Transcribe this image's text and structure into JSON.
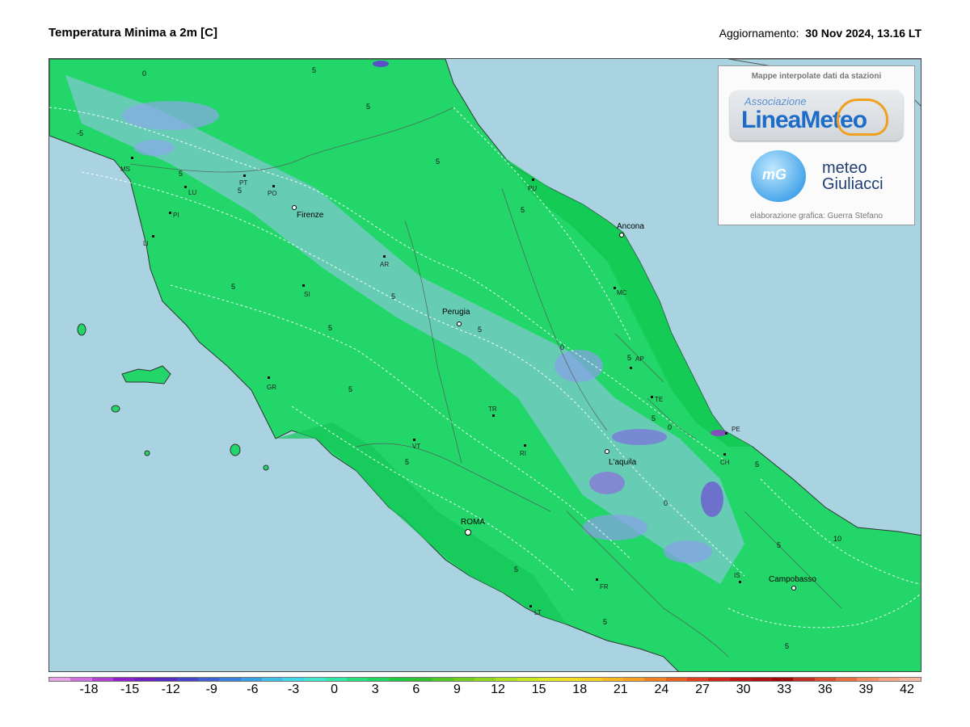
{
  "header": {
    "title": "Temperatura Minima a 2m [C]",
    "updated_label": "Aggiornamento:",
    "updated_value": "30 Nov 2024, 13.16 LT"
  },
  "infobox": {
    "heading": "Mappe interpolate dati da stazioni",
    "logo1_small": "Associazione",
    "logo1_big": "LineaMeteo",
    "logo2_mark": "mG",
    "logo2_line1": "meteo",
    "logo2_line2": "Giuliacci",
    "credit": "elaborazione grafica: Guerra Stefano"
  },
  "map": {
    "sea_color": "#a9d3e0",
    "land_color": "#22d66a",
    "cold_color": "#9fc7f0",
    "cities": [
      "Firenze",
      "Ancona",
      "Perugia",
      "L'aquila",
      "ROMA",
      "Campobasso"
    ],
    "provinces": [
      "MS",
      "LU",
      "PT",
      "PO",
      "PI",
      "LI",
      "SI",
      "AR",
      "GR",
      "PU",
      "MC",
      "AP",
      "TE",
      "PE",
      "CH",
      "TR",
      "VT",
      "RI",
      "FR",
      "LT",
      "IS"
    ],
    "isotherm_labels": [
      "5",
      "0",
      "-5",
      "10"
    ]
  },
  "colorbar": {
    "ticks": [
      "-18",
      "-15",
      "-12",
      "-9",
      "-6",
      "-3",
      "0",
      "3",
      "6",
      "9",
      "12",
      "15",
      "18",
      "21",
      "24",
      "27",
      "30",
      "33",
      "36",
      "39",
      "42"
    ],
    "colors": [
      "#e8a0e8",
      "#d070e0",
      "#b040d0",
      "#9020c8",
      "#7020c0",
      "#5a2cc4",
      "#4a44c8",
      "#4060d0",
      "#3a80d8",
      "#38a0e0",
      "#40c0e8",
      "#40d8e8",
      "#40e8d0",
      "#30e8a8",
      "#28e080",
      "#20d860",
      "#20c840",
      "#30c030",
      "#50c828",
      "#70d020",
      "#90d820",
      "#b0e020",
      "#c8e820",
      "#e0e820",
      "#f0e020",
      "#f8d020",
      "#f8b820",
      "#f8a020",
      "#f08020",
      "#e86020",
      "#e04020",
      "#d02818",
      "#c01810",
      "#b01010",
      "#a00808",
      "#c03020",
      "#d85030",
      "#e87040",
      "#f09060",
      "#f8a880",
      "#f8b8a0"
    ]
  }
}
